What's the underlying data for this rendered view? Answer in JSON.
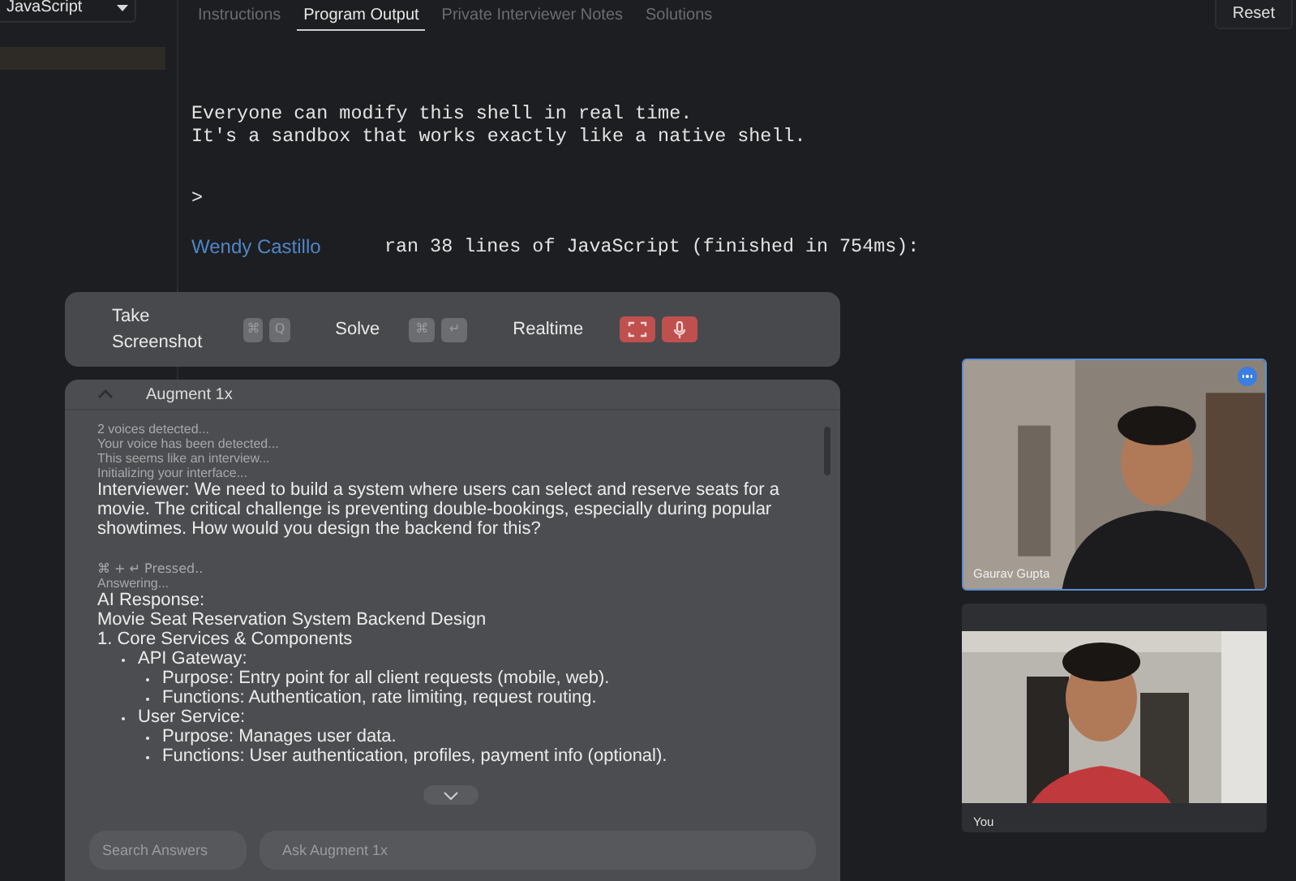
{
  "editor": {
    "language": "JavaScript"
  },
  "tabs": [
    {
      "label": "Instructions",
      "selected": false
    },
    {
      "label": "Program Output",
      "selected": true
    },
    {
      "label": "Private Interviewer Notes",
      "selected": false
    },
    {
      "label": "Solutions",
      "selected": false
    }
  ],
  "reset_button": "Reset",
  "shell": [
    {
      "kind": "text",
      "text": "Everyone can modify this shell in real time."
    },
    {
      "kind": "text",
      "text": "It's a sandbox that works exactly like a native shell."
    },
    {
      "kind": "prompt",
      "text": ">"
    },
    {
      "kind": "run",
      "user": "Wendy Castillo",
      "text": "ran 38 lines of JavaScript (finished in 754ms):"
    }
  ],
  "toolbar": [
    {
      "kind": "action",
      "label": "Take Screenshot",
      "keys": [
        "⌘",
        "Q"
      ]
    },
    {
      "kind": "action",
      "label": "Solve",
      "keys": [
        "⌘",
        "↵"
      ]
    },
    {
      "kind": "realtime",
      "label": "Realtime"
    }
  ],
  "assistant": {
    "title": "Augment 1x",
    "log": [
      {
        "kind": "status",
        "text": "2 voices detected..."
      },
      {
        "kind": "status",
        "text": "Your voice has been detected..."
      },
      {
        "kind": "status",
        "text": "This seems like an interview..."
      },
      {
        "kind": "status",
        "text": "Initializing your interface..."
      },
      {
        "kind": "message",
        "text": "Interviewer: We need to build a system where users can select and reserve seats for a movie. The critical challenge is preventing double-bookings, especially during popular showtimes. How would you design the backend for this?"
      },
      {
        "kind": "gap",
        "text": "⌘ + ↵ Pressed.."
      },
      {
        "kind": "status",
        "text": "Answering..."
      },
      {
        "kind": "message",
        "text": "AI Response:"
      },
      {
        "kind": "message",
        "text": "Movie Seat Reservation System Backend Design"
      }
    ],
    "outline": [
      {
        "text": "1. Core Services & Components",
        "children": [
          {
            "text": "API Gateway:",
            "children": [
              {
                "text": "Purpose: Entry point for all client requests (mobile, web)."
              },
              {
                "text": "Functions: Authentication, rate limiting, request routing."
              }
            ]
          },
          {
            "text": "User Service:",
            "children": [
              {
                "text": "Purpose: Manages user data."
              },
              {
                "text": "Functions: User authentication, profiles, payment info (optional)."
              }
            ]
          }
        ]
      }
    ],
    "search_placeholder": "Search Answers",
    "ask_placeholder": "Ask Augment 1x"
  },
  "participants": [
    {
      "name": "Gaurav Gupta",
      "selected": true
    },
    {
      "name": "You",
      "selected": false
    }
  ]
}
